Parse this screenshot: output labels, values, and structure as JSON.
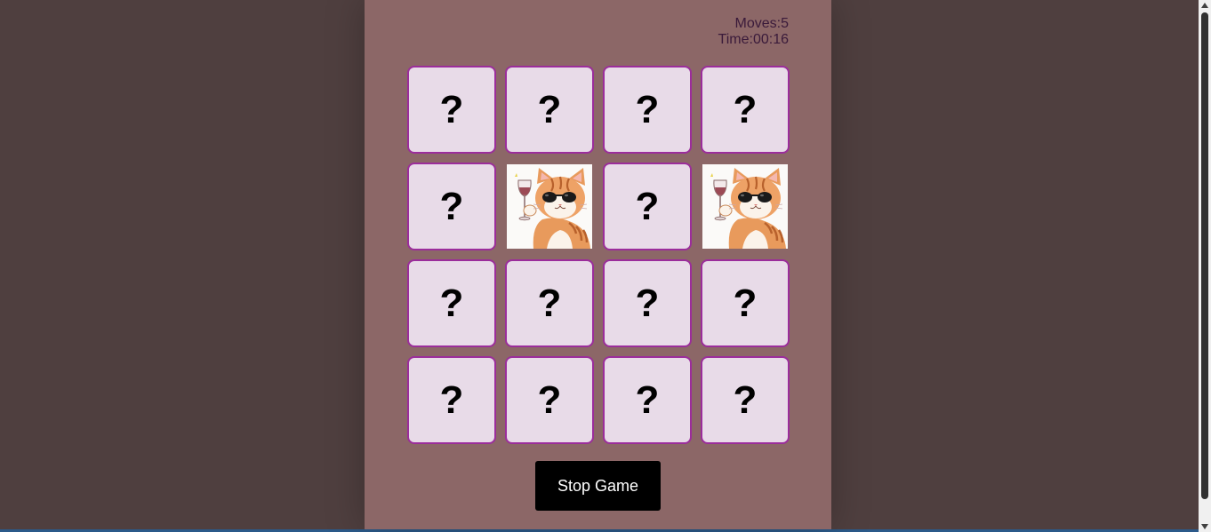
{
  "stats": {
    "moves": "Moves:5",
    "time": "Time:00:16"
  },
  "cards": [
    {
      "state": "hidden",
      "face": "?"
    },
    {
      "state": "hidden",
      "face": "?"
    },
    {
      "state": "hidden",
      "face": "?"
    },
    {
      "state": "hidden",
      "face": "?"
    },
    {
      "state": "hidden",
      "face": "?"
    },
    {
      "state": "revealed",
      "face": "",
      "image": "cat-with-sunglasses-and-wine-glass"
    },
    {
      "state": "hidden",
      "face": "?"
    },
    {
      "state": "revealed",
      "face": "",
      "image": "cat-with-sunglasses-and-wine-glass"
    },
    {
      "state": "hidden",
      "face": "?"
    },
    {
      "state": "hidden",
      "face": "?"
    },
    {
      "state": "hidden",
      "face": "?"
    },
    {
      "state": "hidden",
      "face": "?"
    },
    {
      "state": "hidden",
      "face": "?"
    },
    {
      "state": "hidden",
      "face": "?"
    },
    {
      "state": "hidden",
      "face": "?"
    },
    {
      "state": "hidden",
      "face": "?"
    }
  ],
  "controls": {
    "stop_label": "Stop Game"
  },
  "colors": {
    "page_background": "#4f3f3f",
    "panel_background": "#8c6767",
    "card_background": "#e8dbe8",
    "card_border": "#9b2d9b",
    "button_background": "#000000"
  }
}
